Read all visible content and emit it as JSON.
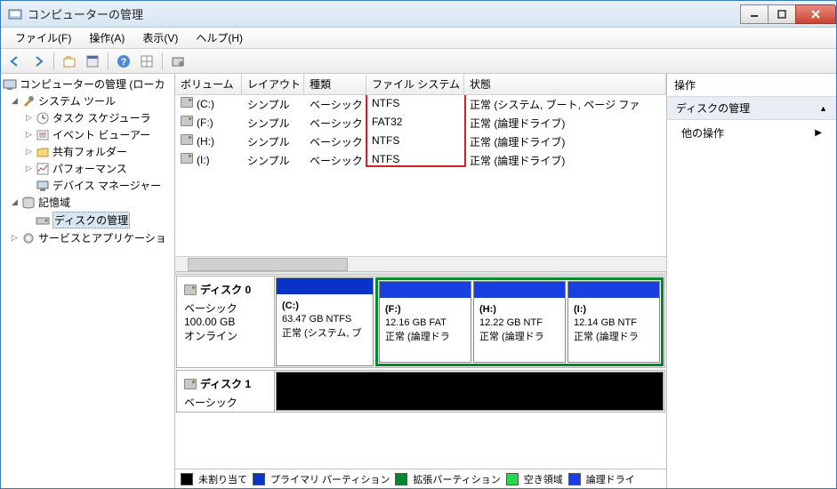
{
  "window": {
    "title": "コンピューターの管理"
  },
  "menubar": [
    "ファイル(F)",
    "操作(A)",
    "表示(V)",
    "ヘルプ(H)"
  ],
  "tree": {
    "root": "コンピューターの管理 (ローカ",
    "systools": {
      "label": "システム ツール",
      "items": [
        "タスク スケジューラ",
        "イベント ビューアー",
        "共有フォルダー",
        "パフォーマンス",
        "デバイス マネージャー"
      ]
    },
    "storage": {
      "label": "記憶域",
      "disk_mgmt": "ディスクの管理"
    },
    "services": "サービスとアプリケーショ"
  },
  "columns": {
    "vol": "ボリューム",
    "layout": "レイアウト",
    "type": "種類",
    "fs": "ファイル システム",
    "status": "状態"
  },
  "volumes": [
    {
      "vol": "(C:)",
      "layout": "シンプル",
      "type": "ベーシック",
      "fs": "NTFS",
      "status": "正常 (システム, ブート, ページ ファ"
    },
    {
      "vol": "(F:)",
      "layout": "シンプル",
      "type": "ベーシック",
      "fs": "FAT32",
      "status": "正常 (論理ドライブ)"
    },
    {
      "vol": "(H:)",
      "layout": "シンプル",
      "type": "ベーシック",
      "fs": "NTFS",
      "status": "正常 (論理ドライブ)"
    },
    {
      "vol": "(I:)",
      "layout": "シンプル",
      "type": "ベーシック",
      "fs": "NTFS",
      "status": "正常 (論理ドライブ)"
    }
  ],
  "disks": [
    {
      "name": "ディスク 0",
      "type": "ベーシック",
      "size": "100.00 GB",
      "state": "オンライン",
      "primary": {
        "label": "(C:)",
        "line2": "63.47 GB NTFS",
        "line3": "正常 (システム, ブ"
      },
      "ext": [
        {
          "label": "(F:)",
          "line2": "12.16 GB FAT",
          "line3": "正常 (論理ドラ"
        },
        {
          "label": "(H:)",
          "line2": "12.22 GB NTF",
          "line3": "正常 (論理ドラ"
        },
        {
          "label": "(I:)",
          "line2": "12.14 GB NTF",
          "line3": "正常 (論理ドラ"
        }
      ]
    },
    {
      "name": "ディスク 1",
      "type": "ベーシック"
    }
  ],
  "legend": {
    "unalloc": "未割り当て",
    "primary": "プライマリ パーティション",
    "ext": "拡張パーティション",
    "free": "空き領域",
    "logical": "論理ドライ"
  },
  "actions": {
    "head": "操作",
    "section": "ディスクの管理",
    "other": "他の操作"
  },
  "colors": {
    "primary": "#0a34c8",
    "extended": "#008a2e",
    "free": "#25d94a",
    "logical": "#1a3fe0",
    "unalloc": "#000000"
  }
}
